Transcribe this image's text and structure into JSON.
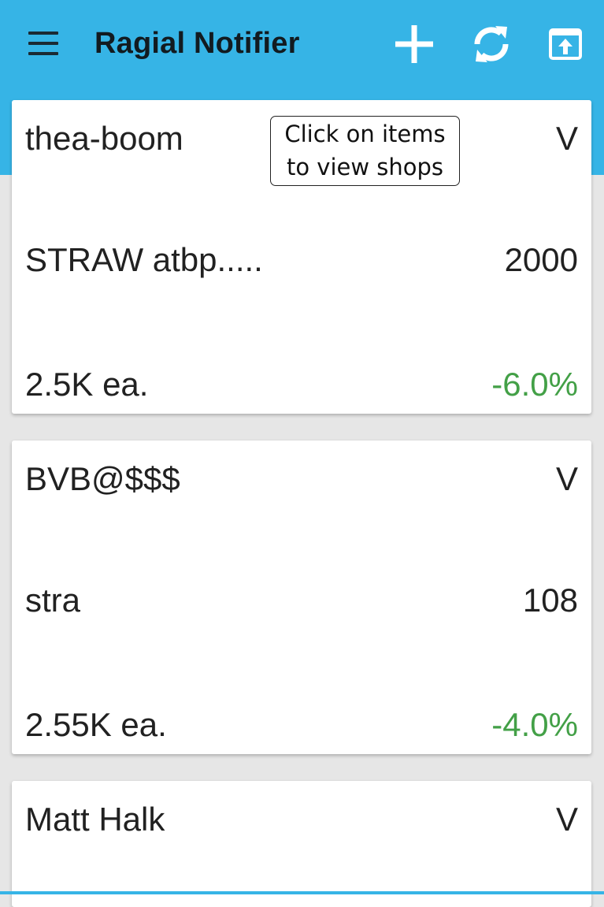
{
  "app": {
    "title": "Ragial Notifier",
    "accent_color": "#36b4e6",
    "positive_change_color": "#43a047"
  },
  "toolbar": {
    "menu_icon": "hamburger-menu-icon",
    "add_icon": "plus-icon",
    "refresh_icon": "refresh-icon",
    "export_icon": "open-in-browser-icon"
  },
  "tooltip": {
    "line1": "Click on items",
    "line2": "to view shops"
  },
  "cards": [
    {
      "seller": "thea-boom",
      "expand": "V",
      "item": "STRAW atbp.....",
      "quantity": "2000",
      "price": "2.5K ea.",
      "change": "-6.0%"
    },
    {
      "seller": "BVB@$$$",
      "expand": "V",
      "item": "stra",
      "quantity": "108",
      "price": "2.55K ea.",
      "change": "-4.0%"
    },
    {
      "seller": "Matt Halk",
      "expand": "V"
    }
  ]
}
